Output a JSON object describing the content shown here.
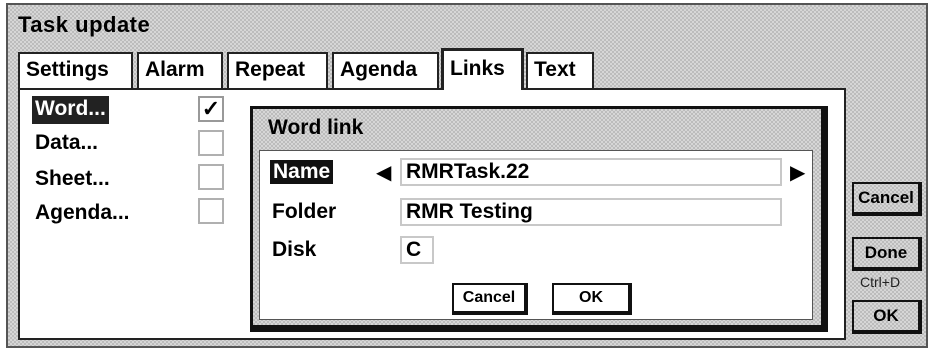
{
  "window": {
    "title": "Task update"
  },
  "tabs": [
    "Settings",
    "Alarm",
    "Repeat",
    "Agenda",
    "Links",
    "Text"
  ],
  "active_tab": "Links",
  "links": {
    "items": [
      {
        "label": "Word...",
        "checked": true,
        "check_mark": "✓"
      },
      {
        "label": "Data...",
        "checked": false,
        "check_mark": ""
      },
      {
        "label": "Sheet...",
        "checked": false,
        "check_mark": ""
      },
      {
        "label": "Agenda...",
        "checked": false,
        "check_mark": ""
      }
    ]
  },
  "side_buttons": {
    "cancel": "Cancel",
    "done": "Done",
    "done_shortcut": "Ctrl+D",
    "ok": "OK"
  },
  "dialog": {
    "title": "Word link",
    "name_label": "Name",
    "name_value": "RMRTask.22",
    "folder_label": "Folder",
    "folder_value": "RMR Testing",
    "disk_label": "Disk",
    "disk_value": "C",
    "cancel": "Cancel",
    "ok": "OK",
    "left_arrow": "◀",
    "right_arrow": "▶"
  }
}
